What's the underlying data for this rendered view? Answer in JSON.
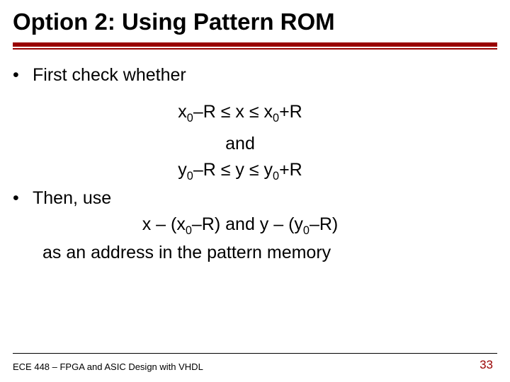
{
  "title": "Option 2: Using Pattern ROM",
  "bullets": {
    "b1": "First check whether",
    "b2": "Then, use"
  },
  "math": {
    "line1_pre": "x",
    "line1_sub1": "0",
    "line1_mid1": "–R  ≤  x ≤  x",
    "line1_sub2": "0",
    "line1_post": "+R",
    "and": "and",
    "line2_pre": "y",
    "line2_sub1": "0",
    "line2_mid1": "–R  ≤  y ≤  y",
    "line2_sub2": "0",
    "line2_post": "+R",
    "addr1_pre": "x – (x",
    "addr1_sub": "0",
    "addr1_mid": "–R) and y – (y",
    "addr1_sub2": "0",
    "addr1_post": "–R)",
    "closing": "as an address in the pattern memory"
  },
  "footer": {
    "left": "ECE 448 – FPGA and ASIC Design with VHDL",
    "right": "33"
  }
}
